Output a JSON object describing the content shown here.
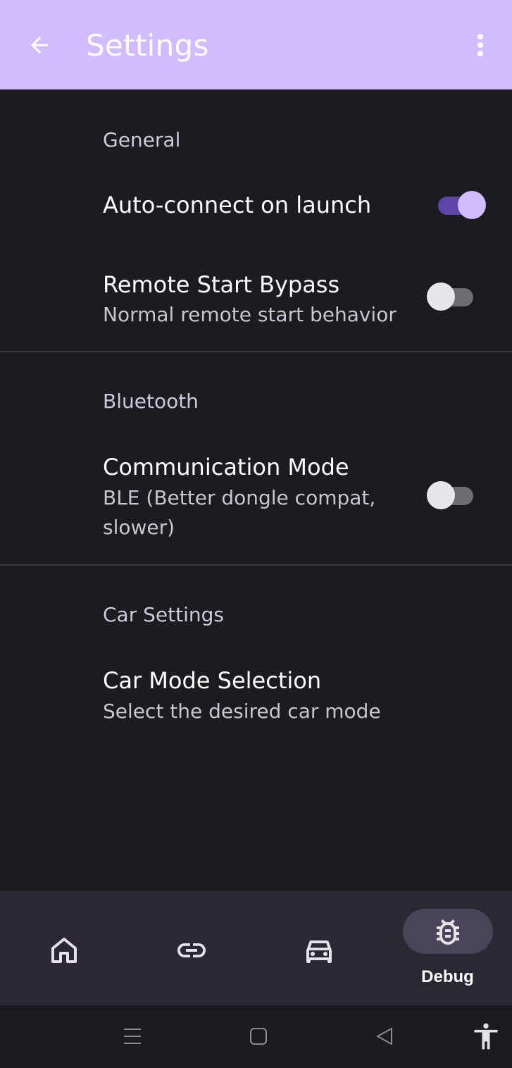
{
  "app_bar": {
    "title": "Settings",
    "back_icon": "arrow-left-icon",
    "more_icon": "more-vertical-icon"
  },
  "sections": [
    {
      "header": "General",
      "items": [
        {
          "label": "Auto-connect on launch",
          "summary": "",
          "switch_on": true
        },
        {
          "label": "Remote Start Bypass",
          "summary": "Normal remote start behavior",
          "switch_on": false
        }
      ]
    },
    {
      "header": "Bluetooth",
      "items": [
        {
          "label": "Communication Mode",
          "summary": "BLE (Better dongle compat, slower)",
          "switch_on": false
        }
      ]
    },
    {
      "header": "Car Settings",
      "items": [
        {
          "label": "Car Mode Selection",
          "summary": "Select the desired car mode"
        }
      ]
    }
  ],
  "bottom_nav": {
    "items": [
      {
        "icon": "home-icon",
        "label": ""
      },
      {
        "icon": "link-icon",
        "label": ""
      },
      {
        "icon": "car-icon",
        "label": ""
      },
      {
        "icon": "bug-icon",
        "label": "Debug",
        "selected": true
      }
    ]
  },
  "system_nav": [
    "menu-icon",
    "home-square-icon",
    "back-triangle-icon",
    "accessibility-icon"
  ],
  "colors": {
    "app_bar": "#d0bcff",
    "background": "#1c1b20",
    "accent": "#d0bcff",
    "switch_track_on": "#5e44a8",
    "nav_bar": "#2a2832",
    "nav_pill": "#4a4458"
  }
}
